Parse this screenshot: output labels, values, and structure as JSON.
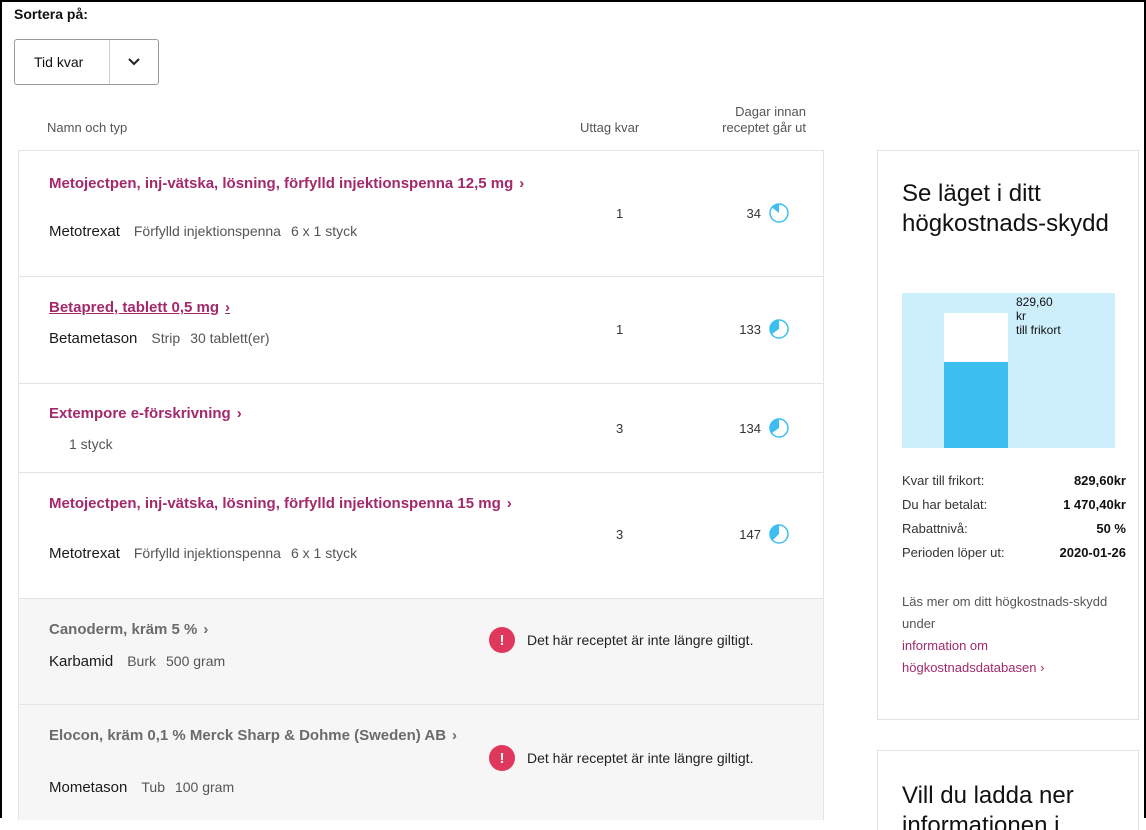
{
  "sort": {
    "label": "Sortera på:",
    "selected": "Tid kvar"
  },
  "columns": {
    "name": "Namn och typ",
    "uttag": "Uttag kvar",
    "days_line1": "Dagar innan",
    "days_line2": "receptet går ut"
  },
  "prescriptions": [
    {
      "name": "Metojectpen, inj-vätska, lösning, förfylld injektionspenna 12,5 mg",
      "substance": "Metotrexat",
      "form": "Förfylld injektionspenna",
      "package": "6 x 1 styck",
      "uttag": "1",
      "days": "34"
    },
    {
      "name": "Betapred, tablett 0,5 mg",
      "substance": "Betametason",
      "form": "Strip",
      "package": "30 tablett(er)",
      "uttag": "1",
      "days": "133"
    },
    {
      "name": "Extempore e-förskrivning",
      "substance": "",
      "form": "",
      "package": "1 styck",
      "uttag": "3",
      "days": "134"
    },
    {
      "name": "Metojectpen, inj-vätska, lösning, förfylld injektionspenna 15 mg",
      "substance": "Metotrexat",
      "form": "Förfylld injektionspenna",
      "package": "6 x 1 styck",
      "uttag": "3",
      "days": "147"
    },
    {
      "name": "Canoderm, kräm 5 %",
      "substance": "Karbamid",
      "form": "Burk",
      "package": "500 gram",
      "warning": "Det här receptet är inte längre giltigt."
    },
    {
      "name": "Elocon, kräm 0,1 % Merck Sharp & Dohme (Sweden) AB",
      "substance": "Mometason",
      "form": "Tub",
      "package": "100 gram",
      "warning": "Det här receptet är inte längre giltigt."
    }
  ],
  "hkskydd": {
    "title": "Se läget i ditt högkostnads-skydd",
    "chart_amount": "829,60",
    "chart_unit": "kr",
    "chart_caption": "till frikort",
    "paid_fraction": 0.64,
    "stats": [
      {
        "label": "Kvar till frikort:",
        "value": "829,60kr"
      },
      {
        "label": "Du har betalat:",
        "value": "1 470,40kr"
      },
      {
        "label": "Rabattnivå:",
        "value": "50 %"
      },
      {
        "label": "Perioden löper ut:",
        "value": "2020-01-26"
      }
    ],
    "info_text": "Läs mer om ditt högkostnads-skydd under",
    "info_link": "information om högkostnadsdatabasen"
  },
  "download_panel": {
    "title": "Vill du ladda ner informationen i"
  },
  "colors": {
    "accent": "#a3296c",
    "bar": "#3cbff0",
    "chart_bg": "#cdeefb",
    "warning": "#e0385d"
  }
}
